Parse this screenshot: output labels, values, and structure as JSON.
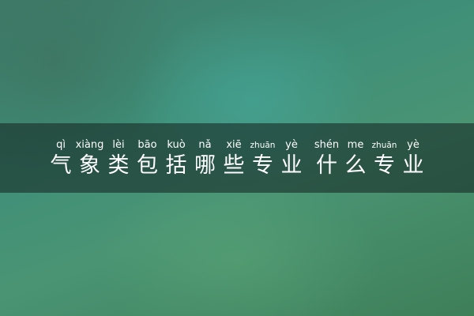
{
  "title": {
    "chars": [
      {
        "hanzi": "气",
        "pinyin": "qì"
      },
      {
        "hanzi": "象",
        "pinyin": "xiàng"
      },
      {
        "hanzi": "类",
        "pinyin": "lèi"
      },
      {
        "hanzi": "包",
        "pinyin": "bāo"
      },
      {
        "hanzi": "括",
        "pinyin": "kuò"
      },
      {
        "hanzi": "哪",
        "pinyin": "nǎ"
      },
      {
        "hanzi": "些",
        "pinyin": "xiē"
      },
      {
        "hanzi": "专",
        "pinyin": "zhuān"
      },
      {
        "hanzi": "业",
        "pinyin": "yè"
      },
      {
        "hanzi": "什",
        "pinyin": "shén"
      },
      {
        "hanzi": "么",
        "pinyin": "me"
      },
      {
        "hanzi": "专",
        "pinyin": "zhuān"
      },
      {
        "hanzi": "业",
        "pinyin": "yè"
      }
    ]
  },
  "colors": {
    "text": "#ffffff",
    "band": "#1f3a33",
    "background": "#3f8f78"
  }
}
